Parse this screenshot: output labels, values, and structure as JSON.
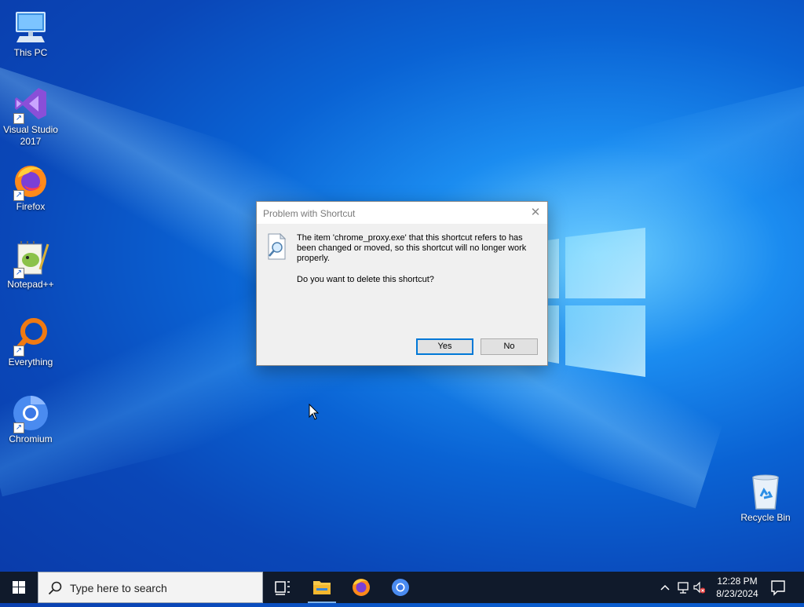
{
  "desktop": {
    "icons": [
      {
        "label": "This PC"
      },
      {
        "label": "Visual Studio 2017"
      },
      {
        "label": "Firefox"
      },
      {
        "label": "Notepad++"
      },
      {
        "label": "Everything"
      },
      {
        "label": "Chromium"
      },
      {
        "label": "Recycle Bin"
      }
    ]
  },
  "dialog": {
    "title": "Problem with Shortcut",
    "message": "The item 'chrome_proxy.exe' that this shortcut refers to has been changed or moved, so this shortcut will no longer work properly.",
    "question": "Do you want to delete this shortcut?",
    "yes_label": "Yes",
    "no_label": "No",
    "close_glyph": "✕"
  },
  "taskbar": {
    "search_placeholder": "Type here to search",
    "clock_time": "12:28 PM",
    "clock_date": "8/23/2024"
  },
  "colors": {
    "accent": "#0078d7",
    "taskbar": "#101a2b"
  }
}
